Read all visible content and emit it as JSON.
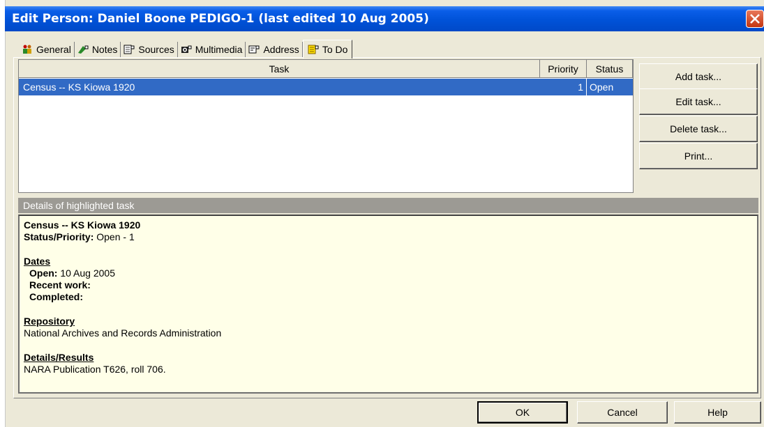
{
  "window": {
    "title": "Edit Person: Daniel Boone PEDIGO-1 (last edited 10 Aug 2005)"
  },
  "tabs": [
    {
      "label": "General",
      "icon": "people-icon"
    },
    {
      "label": "Notes",
      "icon": "notes-icon"
    },
    {
      "label": "Sources",
      "icon": "sources-icon"
    },
    {
      "label": "Multimedia",
      "icon": "camera-icon"
    },
    {
      "label": "Address",
      "icon": "address-card-icon"
    },
    {
      "label": "To Do",
      "icon": "todo-icon"
    }
  ],
  "active_tab": "To Do",
  "task_table": {
    "columns": [
      "Task",
      "Priority",
      "Status"
    ],
    "rows": [
      {
        "task": "Census -- KS Kiowa 1920",
        "priority": "1",
        "status": "Open",
        "selected": true
      }
    ]
  },
  "side_buttons": {
    "add": "Add task...",
    "edit": "Edit task...",
    "delete": "Delete task...",
    "print": "Print..."
  },
  "details": {
    "header": "Details of highlighted task",
    "title": "Census -- KS Kiowa 1920",
    "status_priority_label": "Status/Priority:",
    "status_priority_value": "Open - 1",
    "dates_label": "Dates",
    "open_label": "Open:",
    "open_value": "10 Aug 2005",
    "recent_work_label": "Recent work:",
    "completed_label": "Completed:",
    "repository_label": "Repository",
    "repository_value": "National Archives and Records Administration",
    "results_label": "Details/Results",
    "results_value": "NARA Publication T626, roll 706."
  },
  "bottom_buttons": {
    "ok": "OK",
    "cancel": "Cancel",
    "help": "Help"
  },
  "colors": {
    "titlebar": "#0052d8",
    "selection": "#316ac5",
    "dialog_bg": "#ece9d8",
    "details_bg": "#ffffe8",
    "details_header_bg": "#9c9a94",
    "close_button": "#c3350f"
  }
}
